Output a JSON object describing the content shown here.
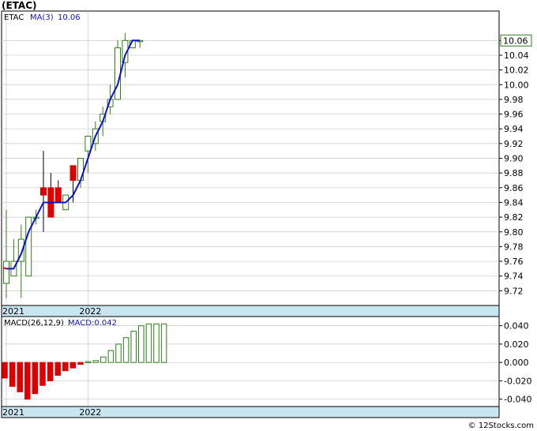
{
  "title": "(ETAC)",
  "watermark": "© 12Stocks.com",
  "chart_data": [
    {
      "type": "candlestick",
      "ticker_label": "ETAC",
      "ma_label": "MA(3)",
      "ma_value_label": "10.06",
      "last_price_label": "10.06",
      "ylim": [
        9.7,
        10.1
      ],
      "y_ticks": [
        {
          "v": 9.72,
          "label": "9.72"
        },
        {
          "v": 9.74,
          "label": "9.74"
        },
        {
          "v": 9.76,
          "label": "9.76"
        },
        {
          "v": 9.78,
          "label": "9.78"
        },
        {
          "v": 9.8,
          "label": "9.80"
        },
        {
          "v": 9.82,
          "label": "9.82"
        },
        {
          "v": 9.84,
          "label": "9.84"
        },
        {
          "v": 9.86,
          "label": "9.86"
        },
        {
          "v": 9.88,
          "label": "9.88"
        },
        {
          "v": 9.9,
          "label": "9.90"
        },
        {
          "v": 9.92,
          "label": "9.92"
        },
        {
          "v": 9.94,
          "label": "9.94"
        },
        {
          "v": 9.96,
          "label": "9.96"
        },
        {
          "v": 9.98,
          "label": "9.98"
        },
        {
          "v": 10.0,
          "label": "10.00"
        },
        {
          "v": 10.02,
          "label": "10.02"
        },
        {
          "v": 10.04,
          "label": "10.04"
        },
        {
          "v": 10.06,
          "label": "10.06"
        }
      ],
      "x_labels": [
        {
          "label": "2021",
          "index": 0
        },
        {
          "label": "2022",
          "index": 11
        }
      ],
      "candles": [
        {
          "o": 9.73,
          "h": 9.83,
          "l": 9.71,
          "c": 9.76,
          "color": "green"
        },
        {
          "o": 9.76,
          "h": 9.79,
          "l": 9.75,
          "c": 9.74,
          "color": "green"
        },
        {
          "o": 9.76,
          "h": 9.81,
          "l": 9.71,
          "c": 9.79,
          "color": "green"
        },
        {
          "o": 9.74,
          "h": 9.82,
          "l": 9.74,
          "c": 9.82,
          "color": "green"
        },
        {
          "o": 9.82,
          "h": 9.83,
          "l": 9.81,
          "c": 9.82,
          "color": "green"
        },
        {
          "o": 9.86,
          "h": 9.91,
          "l": 9.8,
          "c": 9.85,
          "color": "red"
        },
        {
          "o": 9.86,
          "h": 9.88,
          "l": 9.83,
          "c": 9.82,
          "color": "red"
        },
        {
          "o": 9.86,
          "h": 9.87,
          "l": 9.84,
          "c": 9.84,
          "color": "red"
        },
        {
          "o": 9.85,
          "h": 9.85,
          "l": 9.83,
          "c": 9.83,
          "color": "green"
        },
        {
          "o": 9.87,
          "h": 9.88,
          "l": 9.84,
          "c": 9.89,
          "color": "red"
        },
        {
          "o": 9.87,
          "h": 9.89,
          "l": 9.86,
          "c": 9.9,
          "color": "green"
        },
        {
          "o": 9.91,
          "h": 9.92,
          "l": 9.88,
          "c": 9.93,
          "color": "green"
        },
        {
          "o": 9.92,
          "h": 9.95,
          "l": 9.91,
          "c": 9.94,
          "color": "green"
        },
        {
          "o": 9.95,
          "h": 9.97,
          "l": 9.93,
          "c": 9.96,
          "color": "green"
        },
        {
          "o": 9.97,
          "h": 10.0,
          "l": 9.96,
          "c": 9.98,
          "color": "green"
        },
        {
          "o": 9.98,
          "h": 10.06,
          "l": 9.98,
          "c": 10.05,
          "color": "green"
        },
        {
          "o": 10.03,
          "h": 10.07,
          "l": 10.01,
          "c": 10.06,
          "color": "green"
        },
        {
          "o": 10.05,
          "h": 10.06,
          "l": 10.05,
          "c": 10.06,
          "color": "green"
        },
        {
          "o": 10.06,
          "h": 10.06,
          "l": 10.05,
          "c": 10.06,
          "color": "green"
        }
      ],
      "ma": [
        9.75,
        9.75,
        9.77,
        9.8,
        9.82,
        9.84,
        9.84,
        9.84,
        9.84,
        9.85,
        9.87,
        9.9,
        9.93,
        9.95,
        9.98,
        10.0,
        10.04,
        10.06,
        10.06
      ]
    },
    {
      "type": "bar",
      "label": "MACD(26,12,9)",
      "value_label": "MACD:0.042",
      "ylim": [
        -0.048,
        0.05
      ],
      "y_ticks": [
        {
          "v": 0.04,
          "label": "0.040"
        },
        {
          "v": 0.02,
          "label": "0.020"
        },
        {
          "v": 0.0,
          "label": "0.000"
        },
        {
          "v": -0.02,
          "label": "-0.020"
        },
        {
          "v": -0.04,
          "label": "-0.040"
        }
      ],
      "x_labels": [
        {
          "label": "2021",
          "index": 0
        },
        {
          "label": "2022",
          "index": 11
        }
      ],
      "values": [
        -0.017,
        -0.026,
        -0.032,
        -0.04,
        -0.034,
        -0.025,
        -0.02,
        -0.014,
        -0.009,
        -0.006,
        -0.002,
        0.001,
        0.002,
        0.006,
        0.013,
        0.02,
        0.027,
        0.034,
        0.04,
        0.042,
        0.042,
        0.042
      ]
    }
  ]
}
